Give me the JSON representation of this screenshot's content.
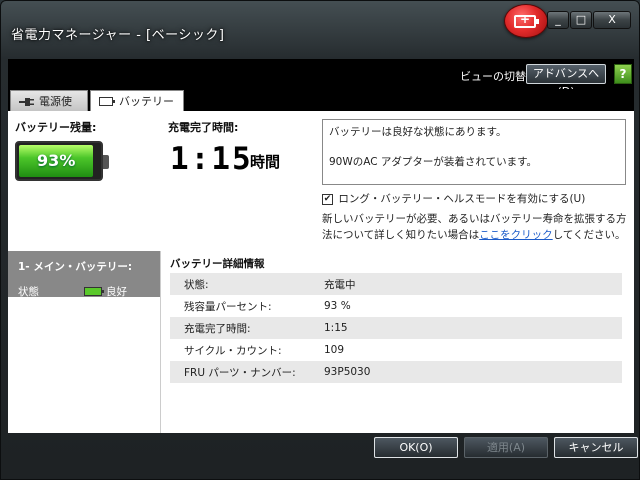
{
  "window": {
    "title": "省電力マネージャー - [ベーシック]",
    "minimize": "_",
    "maximize": "□",
    "close": "X"
  },
  "header": {
    "view_switch_label": "ビューの切替:",
    "advanced_button": "アドバンスへ(D)",
    "help": "?"
  },
  "tabs": [
    {
      "label": "電源使用",
      "icon": "plug-icon"
    },
    {
      "label": "バッテリー",
      "icon": "battery-icon"
    }
  ],
  "battery": {
    "remaining_label": "バッテリー残量:",
    "percent_text": "93%",
    "percent_value": 93,
    "charge_time_label": "充電完了時間:",
    "charge_time": "1:15",
    "charge_time_unit": "時間"
  },
  "messages": {
    "line1": "バッテリーは良好な状態にあります。",
    "line2": "90WのAC アダプターが装着されています。"
  },
  "health_mode": {
    "label": "ロング・バッテリー・ヘルスモードを有効にする(U)",
    "checked": true
  },
  "note": {
    "text_before": "新しいバッテリーが必要、あるいはバッテリー寿命を拡張する方法について詳しく知りたい場合は",
    "link": "ここをクリック",
    "text_after": "してください。"
  },
  "main_battery": {
    "title": "1- メイン・バッテリー:",
    "state_label": "状態",
    "state_value": "良好"
  },
  "details": {
    "title": "バッテリー詳細情報",
    "rows": [
      {
        "key": "状態:",
        "value": "充電中"
      },
      {
        "key": "残容量パーセント:",
        "value": "93 %"
      },
      {
        "key": "充電完了時間:",
        "value": "1:15"
      },
      {
        "key": "サイクル・カウント:",
        "value": "109"
      },
      {
        "key": "FRU パーツ・ナンバー:",
        "value": "93P5030"
      }
    ]
  },
  "buttons": {
    "ok": "OK(O)",
    "apply": "適用(A)",
    "cancel": "キャンセル"
  }
}
